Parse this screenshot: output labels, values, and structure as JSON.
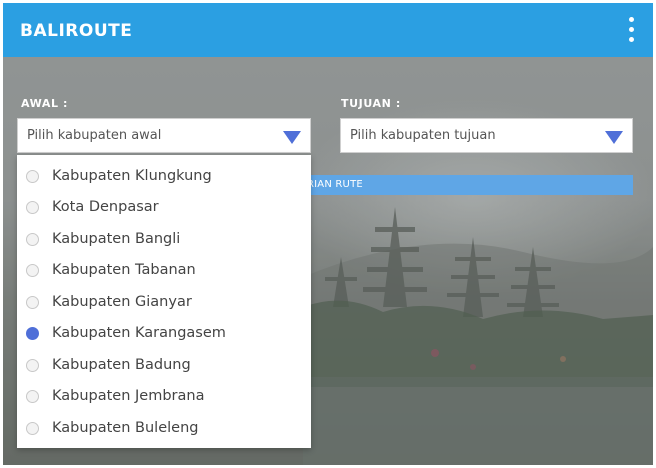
{
  "app": {
    "title": "BALIROUTE"
  },
  "form": {
    "from_label": "AWAL :",
    "from_placeholder": "Pilih kabupaten awal",
    "to_label": "TUJUAN :",
    "to_placeholder": "Pilih kabupaten tujuan",
    "search_button_visible_text": "RIAN RUTE"
  },
  "dropdown": {
    "selected": "Kabupaten Karangasem",
    "options": [
      {
        "label": "Kabupaten Klungkung",
        "checked": false
      },
      {
        "label": "Kota Denpasar",
        "checked": false
      },
      {
        "label": "Kabupaten Bangli",
        "checked": false
      },
      {
        "label": "Kabupaten Tabanan",
        "checked": false
      },
      {
        "label": "Kabupaten Gianyar",
        "checked": false
      },
      {
        "label": "Kabupaten Karangasem",
        "checked": true
      },
      {
        "label": "Kabupaten Badung",
        "checked": false
      },
      {
        "label": "Kabupaten Jembrana",
        "checked": false
      },
      {
        "label": "Kabupaten Buleleng",
        "checked": false
      }
    ]
  },
  "colors": {
    "appbar": "#2b9fe2",
    "accent": "#4f6fd8",
    "search_button": "#5fa6e6"
  },
  "icons": {
    "menu": "more-vert-icon",
    "caret": "triangle-down-icon"
  }
}
